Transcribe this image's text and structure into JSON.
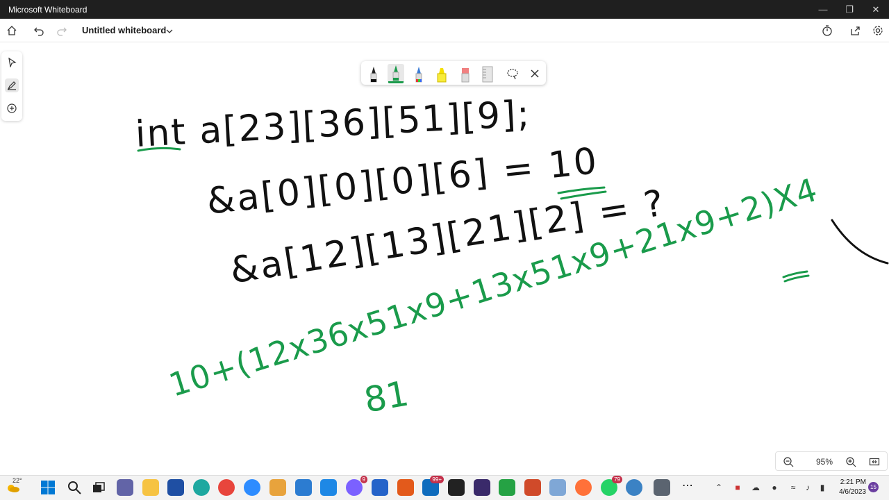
{
  "window": {
    "title": "Microsoft Whiteboard"
  },
  "header": {
    "doc_title": "Untitled whiteboard"
  },
  "zoom": {
    "level": "95%"
  },
  "ink": {
    "line1": "int a[23][36][51][9];",
    "line2": "&a[0][0][0][6] = 10",
    "line3": "&a[12][13][21][2] = ?",
    "line4": "10+(12x36x51x9+13x51x9+21x9+2)X4",
    "line5": "81"
  },
  "taskbar": {
    "weather_temp": "22°",
    "time": "2:21 PM",
    "date": "4/6/2023",
    "notification_count": "15",
    "badges": {
      "messenger": "9",
      "mail": "99+",
      "whatsapp": "79"
    }
  },
  "colors": {
    "ink_black": "#111111",
    "ink_green": "#1a9b4b",
    "titlebar": "#1f1f1f"
  }
}
